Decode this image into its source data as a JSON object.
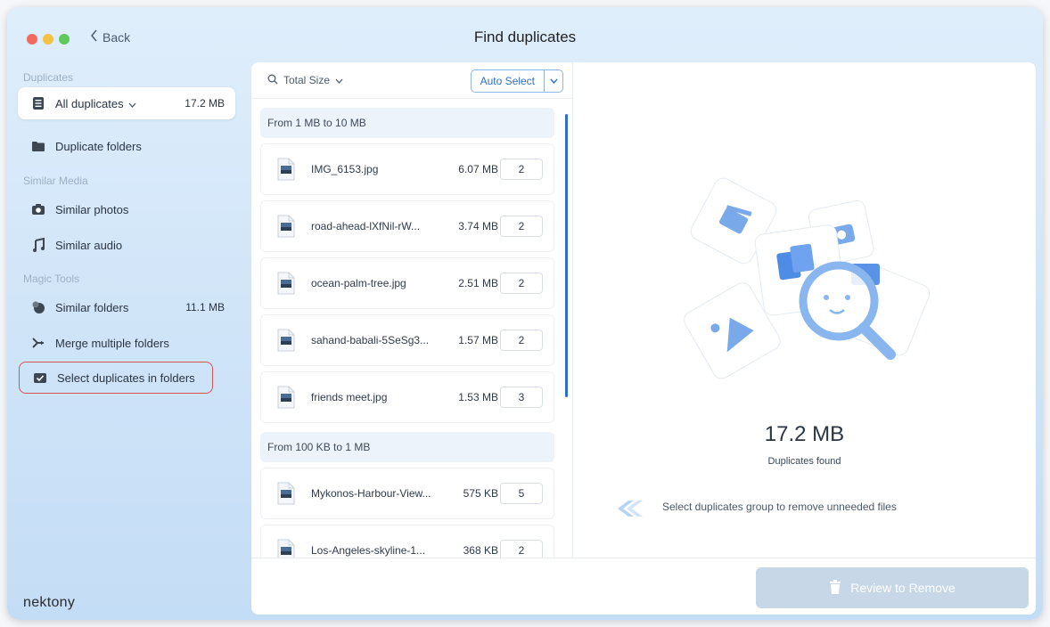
{
  "window": {
    "title": "Find duplicates",
    "back_label": "Back"
  },
  "sidebar": {
    "section_duplicates": "Duplicates",
    "all_duplicates": {
      "label": "All duplicates",
      "size": "17.2 MB"
    },
    "duplicate_folders": "Duplicate folders",
    "section_similar_media": "Similar Media",
    "similar_photos": "Similar photos",
    "similar_audio": "Similar audio",
    "section_magic_tools": "Magic Tools",
    "similar_folders": {
      "label": "Similar folders",
      "size": "11.1 MB"
    },
    "merge_folders": "Merge multiple folders",
    "select_in_folders": "Select duplicates in folders",
    "brand": "nektony"
  },
  "toolbar": {
    "sort_label": "Total Size",
    "auto_select_label": "Auto Select"
  },
  "groups": [
    {
      "label": "From 1 MB to 10 MB",
      "files": [
        {
          "name": "IMG_6153.jpg",
          "size": "6.07 MB",
          "count": "2"
        },
        {
          "name": "road-ahead-lXfNil-rW...",
          "size": "3.74 MB",
          "count": "2"
        },
        {
          "name": "ocean-palm-tree.jpg",
          "size": "2.51 MB",
          "count": "2"
        },
        {
          "name": "sahand-babali-5SeSg3...",
          "size": "1.57 MB",
          "count": "2"
        },
        {
          "name": "friends meet.jpg",
          "size": "1.53 MB",
          "count": "3"
        }
      ]
    },
    {
      "label": "From 100 KB to 1 MB",
      "files": [
        {
          "name": "Mykonos-Harbour-View...",
          "size": "575 KB",
          "count": "5"
        },
        {
          "name": "Los-Angeles-skyline-1...",
          "size": "368 KB",
          "count": "2"
        }
      ]
    }
  ],
  "summary": {
    "total": "17.2 MB",
    "caption": "Duplicates found",
    "hint": "Select duplicates group to remove unneeded files"
  },
  "footer": {
    "review_label": "Review to Remove"
  },
  "colors": {
    "accent": "#2f6fc6",
    "highlight_circle": "#d9534f",
    "disabled_button": "#c7d7e8"
  }
}
